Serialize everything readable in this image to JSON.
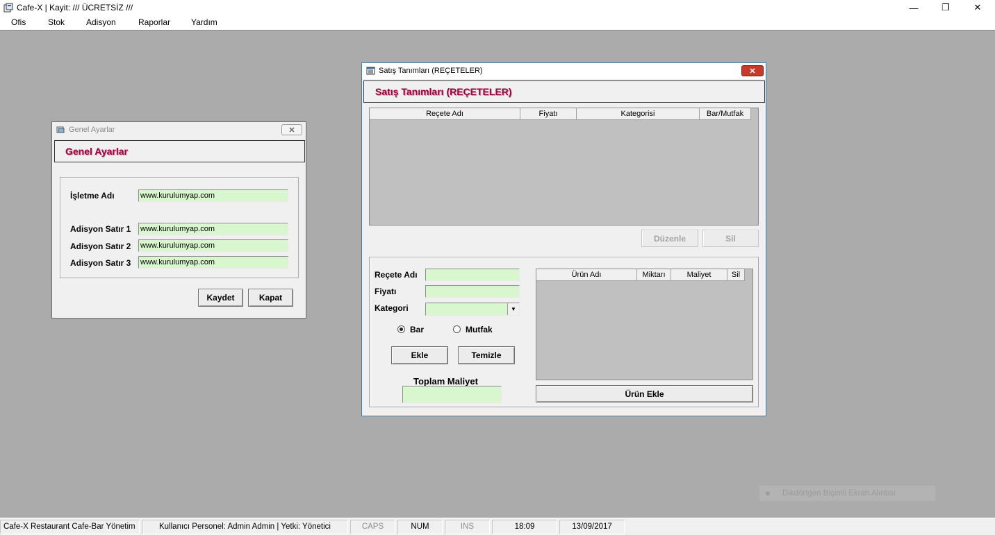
{
  "window": {
    "title": "Cafe-X  |  Kayit:  /// ÜCRETSİZ ///",
    "controls": {
      "minimize": "—",
      "restore": "❐",
      "close": "✕"
    }
  },
  "menu": [
    "Ofis",
    "Stok",
    "Adisyon",
    "Raporlar",
    "Yardım"
  ],
  "genel_ayarlar": {
    "window_title": "Genel Ayarlar",
    "header": "Genel Ayarlar",
    "close_glyph": "✕",
    "fields": [
      {
        "label": "İşletme Adı",
        "value": "www.kurulumyap.com"
      },
      {
        "label": "Adisyon Satır 1",
        "value": "www.kurulumyap.com"
      },
      {
        "label": "Adisyon Satır 2",
        "value": "www.kurulumyap.com"
      },
      {
        "label": "Adisyon Satır 3",
        "value": "www.kurulumyap.com"
      }
    ],
    "buttons": {
      "save": "Kaydet",
      "close": "Kapat"
    }
  },
  "satis_tanimlari": {
    "window_title": "Satış Tanımları (REÇETELER)",
    "header": "Satış Tanımları  (REÇETELER)",
    "close_glyph": "✕",
    "recipe_grid": {
      "columns": [
        "Reçete Adı",
        "Fiyatı",
        "Kategorisi",
        "Bar/Mutfak"
      ],
      "rows": []
    },
    "buttons": {
      "edit": "Düzenle",
      "delete": "Sil",
      "add": "Ekle",
      "clear": "Temizle",
      "add_product": "Ürün Ekle"
    },
    "form": {
      "recipe_name_label": "Reçete Adı",
      "recipe_name_value": "",
      "price_label": "Fiyatı",
      "price_value": "",
      "category_label": "Kategori",
      "category_value": "",
      "radio_bar": "Bar",
      "radio_mutfak": "Mutfak",
      "selected": "Bar",
      "total_cost_label": "Toplam Maliyet",
      "total_cost_value": ""
    },
    "product_grid": {
      "columns": [
        "Ürün Adı",
        "Miktarı",
        "Maliyet",
        "Sil"
      ],
      "rows": []
    }
  },
  "statusbar": [
    "Cafe-X Restaurant Cafe-Bar Yönetim",
    "Kullanıcı Personel: Admin Admin  |  Yetki: Yönetici",
    "CAPS",
    "NUM",
    "INS",
    "18:09",
    "13/09/2017"
  ],
  "overlay_hint": "Dikdörtgen Biçimli Ekran Alıntısı",
  "colors": {
    "mdi_background": "#ababab",
    "field_background": "#d9f7cf",
    "header_text": "#a0003c",
    "close_button": "#c8392b"
  }
}
